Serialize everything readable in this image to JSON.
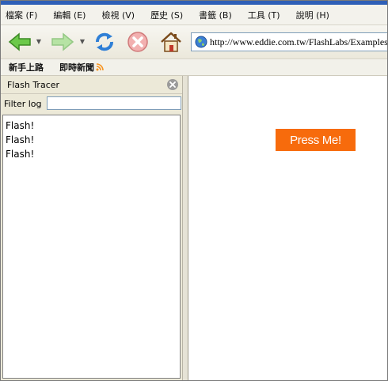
{
  "menu": [
    "檔案 (F)",
    "編輯 (E)",
    "檢視 (V)",
    "歷史 (S)",
    "書籤 (B)",
    "工具 (T)",
    "說明 (H)"
  ],
  "navigation": {
    "back_icon": "green-left-arrow",
    "forward_icon": "green-right-arrow",
    "reload_icon": "blue-refresh-arrows",
    "stop_icon": "red-stop-x",
    "home_icon": "house",
    "url": "http://www.eddie.com.tw/FlashLabs/Examples/tr"
  },
  "bookmarks": [
    {
      "label": "新手上路",
      "icon": ""
    },
    {
      "label": "即時新聞",
      "icon": "rss-icon"
    }
  ],
  "sidebar": {
    "title": "Flash Tracer",
    "filter_label": "Filter log",
    "filter_value": "",
    "log_lines": [
      "Flash!",
      "Flash!",
      "Flash!"
    ]
  },
  "content": {
    "button_label": "Press Me!",
    "button_color": "#f76b0c"
  },
  "colors": {
    "accent": "#2e5fb7",
    "nav_green": "#58b83a",
    "stop_red": "#e06060"
  }
}
